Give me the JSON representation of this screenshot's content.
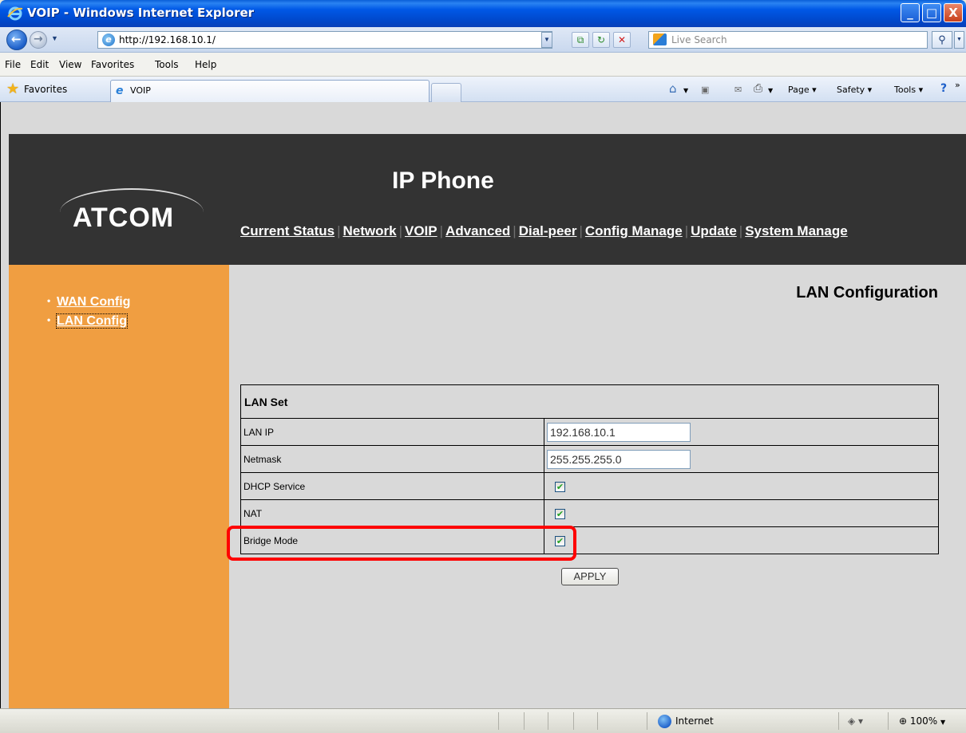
{
  "window": {
    "title": "VOIP - Windows Internet Explorer",
    "minimize_glyph": "_",
    "maximize_glyph": "□",
    "close_glyph": "X"
  },
  "address_bar": {
    "url": "http://192.168.10.1/",
    "search_placeholder": "Live Search"
  },
  "menu": {
    "items": [
      "File",
      "Edit",
      "View",
      "Favorites",
      "Tools",
      "Help"
    ]
  },
  "favorites_bar": {
    "favorites_label": "Favorites",
    "tab_label": "VOIP",
    "commands": [
      "Page ▾",
      "Safety ▾",
      "Tools ▾"
    ]
  },
  "site": {
    "logo": "ATCOM",
    "title": "IP Phone",
    "nav": [
      "Current Status",
      "Network",
      "VOIP",
      "Advanced",
      "Dial-peer",
      "Config Manage",
      "Update",
      "System Manage"
    ]
  },
  "sidebar": {
    "items": [
      {
        "label": "WAN Config",
        "active": false
      },
      {
        "label": "LAN Config",
        "active": true
      }
    ]
  },
  "main": {
    "heading": "LAN Configuration",
    "table_title": "LAN Set",
    "rows": [
      {
        "label": "LAN IP",
        "type": "text",
        "value": "192.168.10.1"
      },
      {
        "label": "Netmask",
        "type": "text",
        "value": "255.255.255.0"
      },
      {
        "label": "DHCP Service",
        "type": "checkbox",
        "checked": true
      },
      {
        "label": "NAT",
        "type": "checkbox",
        "checked": true
      },
      {
        "label": "Bridge Mode",
        "type": "checkbox",
        "checked": true
      }
    ],
    "apply_label": "APPLY"
  },
  "status_bar": {
    "zone": "Internet",
    "zoom": "100%"
  },
  "colors": {
    "header_bg": "#333333",
    "sidebar_bg": "#f09e41",
    "content_bg": "#d9d9d9",
    "highlight": "#ff0000"
  }
}
